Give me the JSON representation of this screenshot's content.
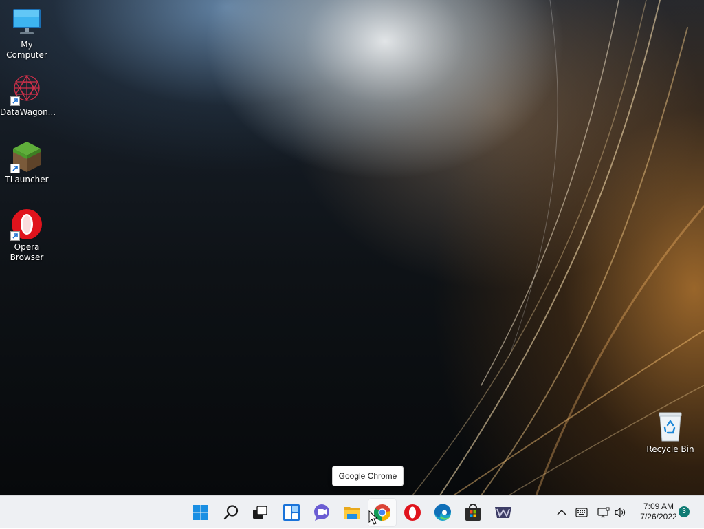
{
  "desktop": {
    "icons": [
      {
        "label": "My Computer",
        "icon": "monitor-icon"
      },
      {
        "label": "DataWagon...",
        "icon": "datawagon-icon"
      },
      {
        "label": "TLauncher",
        "icon": "minecraft-grass-block-icon"
      },
      {
        "label": "Opera\nBrowser",
        "icon": "opera-icon"
      },
      {
        "label": "Recycle Bin",
        "icon": "recycle-bin-icon"
      }
    ]
  },
  "tooltip": {
    "text": "Google Chrome"
  },
  "taskbar": {
    "apps": [
      {
        "name": "Start",
        "icon": "windows-start-icon"
      },
      {
        "name": "Search",
        "icon": "search-icon"
      },
      {
        "name": "Task View",
        "icon": "task-view-icon"
      },
      {
        "name": "Widgets",
        "icon": "widgets-icon"
      },
      {
        "name": "Chat",
        "icon": "teams-chat-icon"
      },
      {
        "name": "File Explorer",
        "icon": "folder-icon"
      },
      {
        "name": "Google Chrome",
        "icon": "chrome-icon"
      },
      {
        "name": "Opera",
        "icon": "opera-icon"
      },
      {
        "name": "Microsoft Edge",
        "icon": "edge-icon"
      },
      {
        "name": "Microsoft Store",
        "icon": "store-icon"
      },
      {
        "name": "WinRAR",
        "icon": "winrar-icon"
      }
    ],
    "tray": {
      "icons": [
        "chevron-up-icon",
        "keyboard-icon",
        "network-icon",
        "volume-icon"
      ],
      "time": "7:09 AM",
      "date": "7/26/2022",
      "notification_count": "3"
    }
  },
  "colors": {
    "taskbar_bg": "#eef0f3",
    "accent_windows": "#1a8fe3",
    "opera_red": "#e0131c",
    "badge": "#0f7b74"
  }
}
